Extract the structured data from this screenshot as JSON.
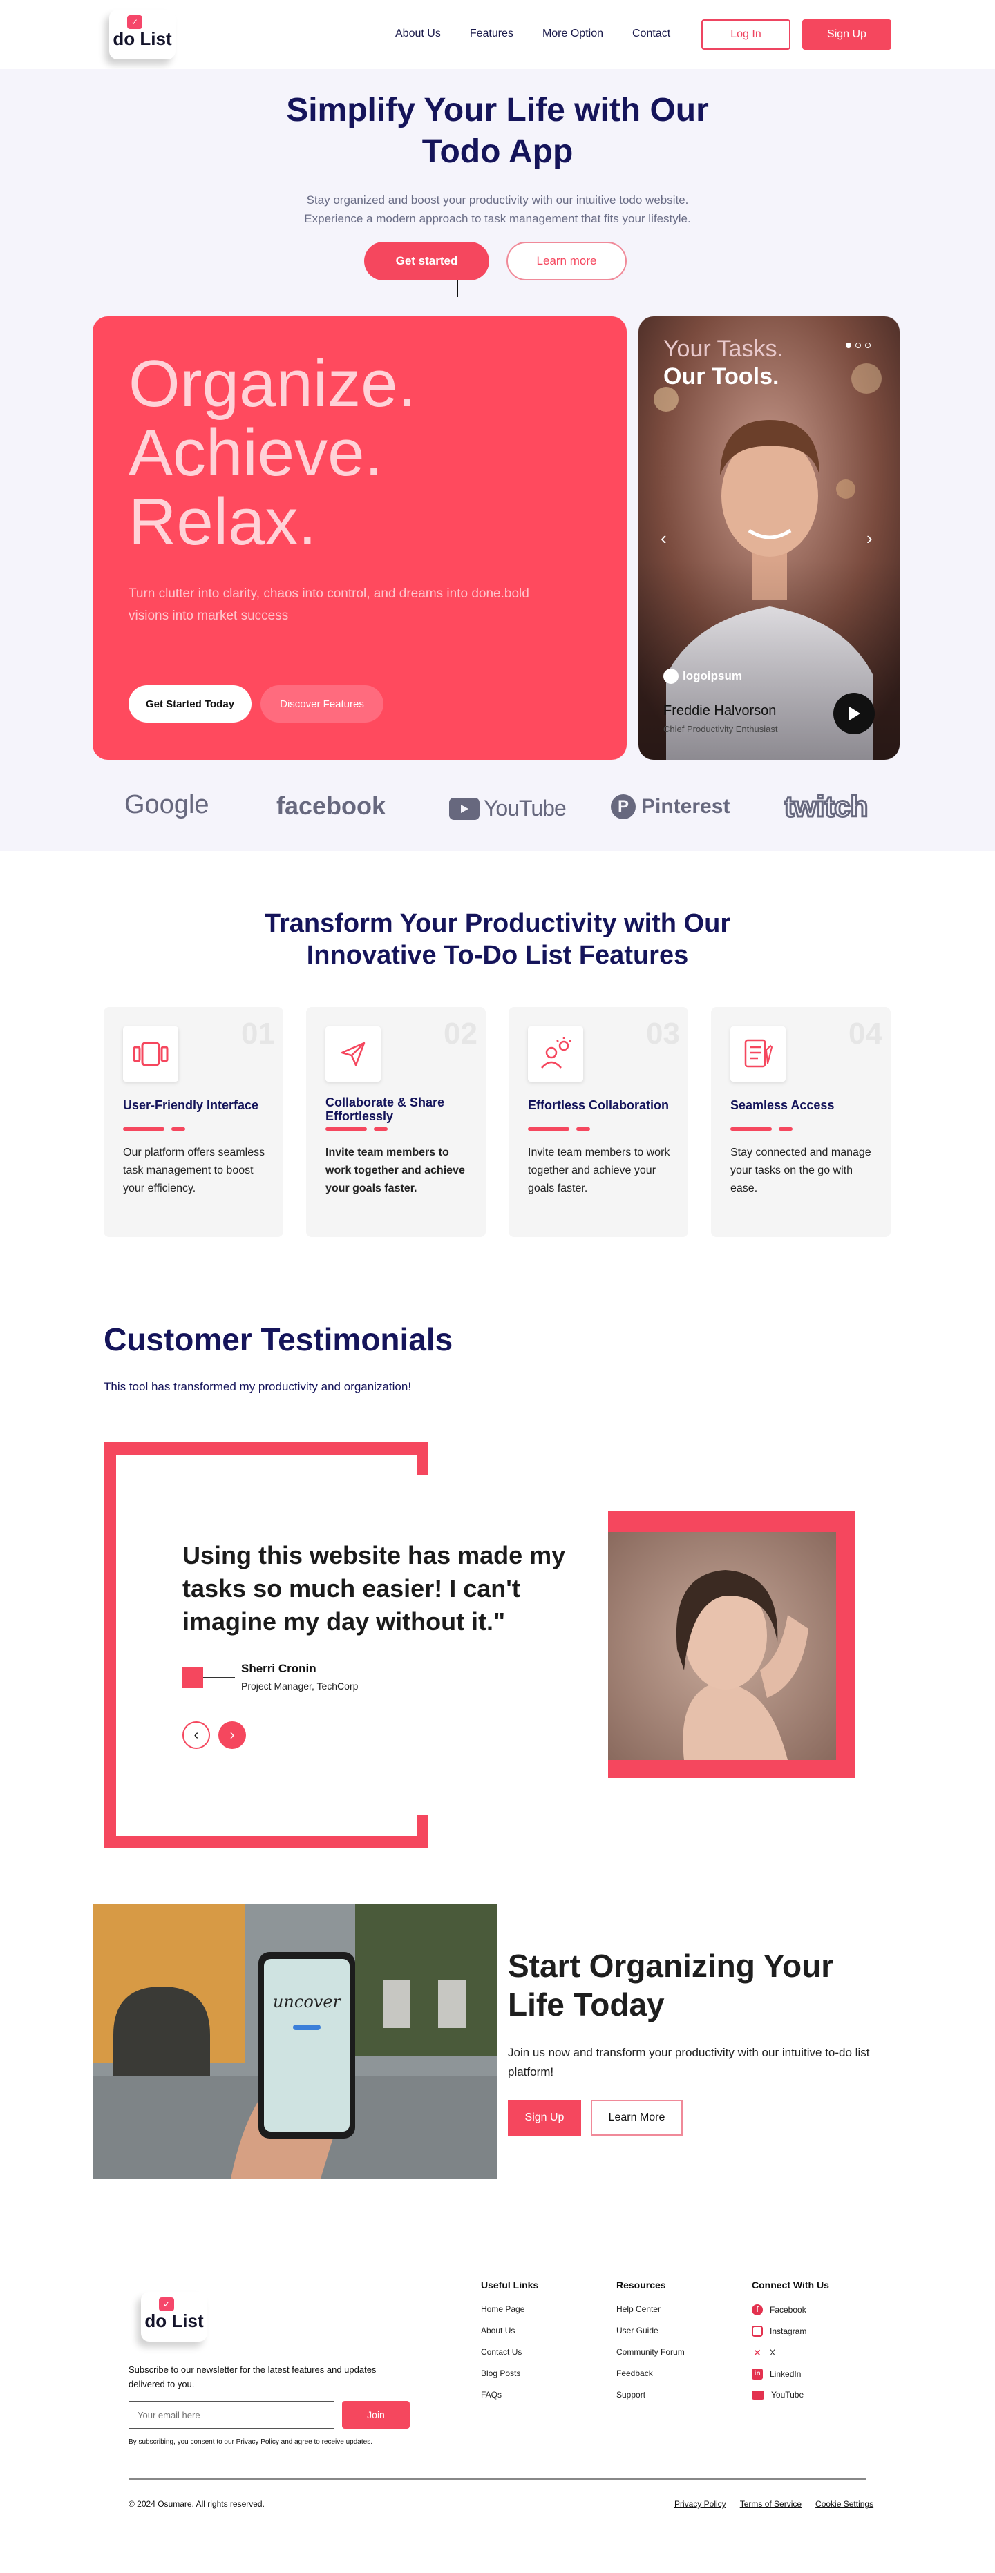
{
  "header": {
    "logo_text": "do List",
    "nav": [
      "About Us",
      "Features",
      "More Option",
      "Contact"
    ],
    "login": "Log In",
    "signup": "Sign Up"
  },
  "hero": {
    "title_line1": "Simplify Your Life with Our",
    "title_line2": "Todo App",
    "sub_line1": "Stay organized and boost your productivity with our intuitive todo website.",
    "sub_line2": "Experience a modern approach to task management that fits your lifestyle.",
    "cta_primary": "Get started",
    "cta_secondary": "Learn more",
    "big_line1": "Organize.",
    "big_line2": "Achieve.",
    "big_line3": "Relax.",
    "card_text": "Turn clutter into clarity, chaos into control, and dreams into done.bold visions into market success",
    "card_btn1": "Get Started Today",
    "card_btn2": "Discover Features",
    "photo_line1": "Your Tasks.",
    "photo_line2": "Our Tools.",
    "photo_logo": "logoipsum",
    "photo_name": "Freddie Halvorson",
    "photo_role": "Chief Productivity Enthusiast"
  },
  "brands": [
    "Google",
    "facebook",
    "YouTube",
    "Pinterest",
    "twitch"
  ],
  "features": {
    "title_line1": "Transform Your Productivity with Our",
    "title_line2": "Innovative To-Do List Features",
    "cards": [
      {
        "num": "01",
        "title": "User-Friendly Interface",
        "desc": "Our platform offers seamless task management to boost your efficiency.",
        "icon": "layout-icon"
      },
      {
        "num": "02",
        "title": "Collaborate & Share Effortlessly",
        "desc": "Invite team members to work together and achieve your goals faster.",
        "icon": "paper-plane-icon"
      },
      {
        "num": "03",
        "title": "Effortless Collaboration",
        "desc": "Invite team members to work together and achieve your goals faster.",
        "icon": "idea-user-icon"
      },
      {
        "num": "04",
        "title": "Seamless Access",
        "desc": "Stay connected and manage your tasks on the go with ease.",
        "icon": "checklist-icon"
      }
    ]
  },
  "testimonials": {
    "title": "Customer Testimonials",
    "sub": "This tool has transformed my productivity and organization!",
    "quote": "Using this website has made my tasks so much easier! I can't imagine my day without it.\"",
    "name": "Sherri Cronin",
    "role": "Project Manager, TechCorp"
  },
  "cta": {
    "title_line1": "Start Organizing Your",
    "title_line2": "Life Today",
    "text": "Join us now and transform your productivity with our intuitive to-do list platform!",
    "signup": "Sign Up",
    "learn": "Learn More",
    "phone_text": "uncover"
  },
  "footer": {
    "logo_text": "do List",
    "newsletter": "Subscribe to our newsletter for the latest features and updates delivered to you.",
    "email_placeholder": "Your email here",
    "join": "Join",
    "consent": "By subscribing, you consent to our Privacy Policy and agree to receive updates.",
    "useful_title": "Useful Links",
    "useful": [
      "Home Page",
      "About Us",
      "Contact Us",
      "Blog Posts",
      "FAQs"
    ],
    "res_title": "Resources",
    "resources": [
      "Help Center",
      "User Guide",
      "Community Forum",
      "Feedback",
      "Support"
    ],
    "social_title": "Connect With Us",
    "social": [
      "Facebook",
      "Instagram",
      "X",
      "LinkedIn",
      "YouTube"
    ],
    "copyright": "© 2024 Osumare. All rights reserved.",
    "legal": [
      "Privacy Policy",
      "Terms of Service",
      "Cookie Settings"
    ]
  },
  "colors": {
    "accent": "#F5475E",
    "navy": "#15145A",
    "hero_bg": "#F5F4FB"
  }
}
